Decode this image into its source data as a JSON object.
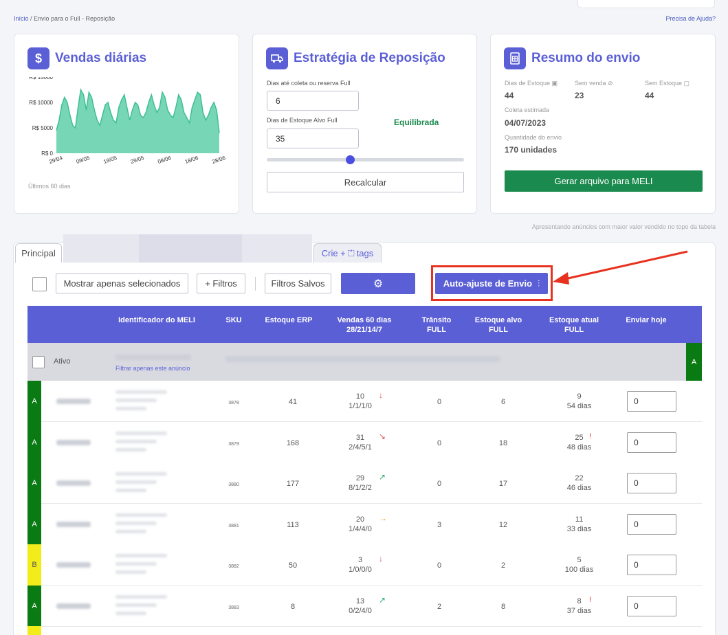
{
  "breadcrumb": {
    "home": "Início",
    "rest": " / Envio para o Full - Reposição"
  },
  "help_link": "Precisa de Ajuda?",
  "sales_card": {
    "title": "Vendas diárias",
    "icon": "dollar-icon",
    "footer": "Últimos 60 dias",
    "y_ticks": [
      "R$ 15000",
      "R$ 10000",
      "R$ 5000",
      "R$ 0"
    ],
    "x_ticks": [
      "29/04",
      "09/05",
      "19/05",
      "29/05",
      "08/06",
      "18/06",
      "28/06"
    ],
    "color": "#5ecfa9"
  },
  "chart_data": {
    "type": "area",
    "title": "",
    "xlabel": "",
    "ylabel": "",
    "ylim": [
      0,
      15000
    ],
    "x": [
      "29/04",
      "30/04",
      "01/05",
      "02/05",
      "03/05",
      "04/05",
      "05/05",
      "06/05",
      "07/05",
      "08/05",
      "09/05",
      "10/05",
      "11/05",
      "12/05",
      "13/05",
      "14/05",
      "15/05",
      "16/05",
      "17/05",
      "18/05",
      "19/05",
      "20/05",
      "21/05",
      "22/05",
      "23/05",
      "24/05",
      "25/05",
      "26/05",
      "27/05",
      "28/05",
      "29/05",
      "30/05",
      "31/05",
      "01/06",
      "02/06",
      "03/06",
      "04/06",
      "05/06",
      "06/06",
      "07/06",
      "08/06",
      "09/06",
      "10/06",
      "11/06",
      "12/06",
      "13/06",
      "14/06",
      "15/06",
      "16/06",
      "17/06",
      "18/06",
      "19/06",
      "20/06",
      "21/06",
      "22/06",
      "23/06",
      "24/06",
      "25/06",
      "26/06",
      "27/06",
      "28/06"
    ],
    "series": [
      {
        "values": [
          4500,
          6500,
          9500,
          11000,
          10000,
          7500,
          5500,
          5000,
          9000,
          12500,
          11500,
          8500,
          12000,
          11000,
          8500,
          6500,
          5500,
          7500,
          9500,
          10000,
          8000,
          6500,
          6000,
          9000,
          10500,
          11500,
          9000,
          6500,
          8500,
          10000,
          9500,
          7500,
          7000,
          8000,
          10000,
          11500,
          9500,
          8000,
          9000,
          12000,
          11000,
          8500,
          7500,
          7000,
          9000,
          11500,
          10500,
          8000,
          7000,
          6000,
          9000,
          10500,
          12000,
          11500,
          8000,
          6500,
          7500,
          9000,
          10000,
          8500,
          4000
        ]
      }
    ]
  },
  "strategy_card": {
    "title": "Estratégia de Reposição",
    "icon": "truck-icon",
    "field1_label": "Dias até coleta ou reserva Full",
    "field1_value": "6",
    "field2_label": "Dias de Estoque Alvo Full",
    "field2_value": "35",
    "status": "Equilibrada",
    "slider_value": 0.42,
    "button": "Recalcular"
  },
  "summary_card": {
    "title": "Resumo do envio",
    "icon": "document-icon",
    "dias_estoque_label": "Dias de Estoque",
    "dias_estoque_value": "44",
    "sem_venda_label": "Sem venda",
    "sem_venda_value": "23",
    "sem_estoque_label": "Sem Estoque",
    "sem_estoque_value": "44",
    "coleta_label": "Coleta estimada",
    "coleta_value": "04/07/2023",
    "qtd_label": "Quantidade do envio",
    "qtd_value": "170 unidades",
    "button": "Gerar arquivo para MELI",
    "button_color": "#1b8a4e"
  },
  "table_note": "Apresentando anúncios com maior valor vendido no topo da tabela",
  "tabs": {
    "main": "Principal",
    "create": "Crie +",
    "tags": "tags"
  },
  "toolbar": {
    "show_selected": "Mostrar apenas selecionados",
    "filters": "+ Filtros",
    "saved_filters": "Filtros Salvos",
    "auto_adjust": "Auto-ajuste de Envio"
  },
  "columns": {
    "meli_id": "Identificador do MELI",
    "sku": "SKU",
    "erp": "Estoque ERP",
    "sales_l1": "Vendas 60 dias",
    "sales_l2": "28/21/14/7",
    "transit_l1": "Trânsito",
    "transit_l2": "FULL",
    "target_l1": "Estoque alvo",
    "target_l2": "FULL",
    "current_l1": "Estoque atual",
    "current_l2": "FULL",
    "send": "Enviar hoje"
  },
  "filter_row": {
    "active": "Ativo",
    "filter_link": "Filtrar apenas este anúncio",
    "badge": "A"
  },
  "rows": [
    {
      "cls": "A",
      "color": "#0a7a12",
      "sku": "3878",
      "erp": "41",
      "sales": "10",
      "breakdown": "1/1/1/0",
      "trend": "↓",
      "trend_color": "#e05555",
      "transit": "0",
      "target": "6",
      "stock": "9",
      "days": "54 dias",
      "alert": "",
      "send": "0"
    },
    {
      "cls": "A",
      "color": "#0a7a12",
      "sku": "3879",
      "erp": "168",
      "sales": "31",
      "breakdown": "2/4/5/1",
      "trend": "↘",
      "trend_color": "#e05555",
      "transit": "0",
      "target": "18",
      "stock": "25",
      "days": "48 dias",
      "alert": "!",
      "send": "0"
    },
    {
      "cls": "A",
      "color": "#0a7a12",
      "sku": "3880",
      "erp": "177",
      "sales": "29",
      "breakdown": "8/1/2/2",
      "trend": "↗",
      "trend_color": "#2eaa6a",
      "transit": "0",
      "target": "17",
      "stock": "22",
      "days": "46 dias",
      "alert": "",
      "send": "0"
    },
    {
      "cls": "A",
      "color": "#0a7a12",
      "sku": "3881",
      "erp": "113",
      "sales": "20",
      "breakdown": "1/4/4/0",
      "trend": "→",
      "trend_color": "#f0a040",
      "transit": "3",
      "target": "12",
      "stock": "11",
      "days": "33 dias",
      "alert": "",
      "send": "0"
    },
    {
      "cls": "B",
      "color": "#f2ec1a",
      "sku": "3882",
      "erp": "50",
      "sales": "3",
      "breakdown": "1/0/0/0",
      "trend": "↓",
      "trend_color": "#e05555",
      "transit": "0",
      "target": "2",
      "stock": "5",
      "days": "100 dias",
      "alert": "",
      "send": "0"
    },
    {
      "cls": "A",
      "color": "#0a7a12",
      "sku": "3883",
      "erp": "8",
      "sales": "13",
      "breakdown": "0/2/4/0",
      "trend": "↗",
      "trend_color": "#2eaa6a",
      "transit": "2",
      "target": "8",
      "stock": "8",
      "days": "37 dias",
      "alert": "!",
      "send": "0"
    }
  ],
  "annotation_arrow_color": "#e8321f"
}
